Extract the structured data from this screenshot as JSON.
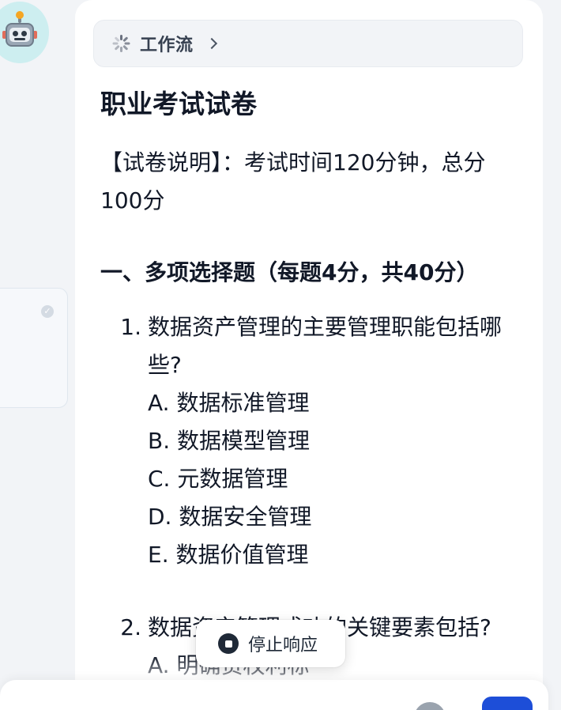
{
  "avatar": {
    "icon": "robot-icon"
  },
  "workflow": {
    "label": "工作流"
  },
  "document": {
    "title": "职业考试试卷",
    "description": "【试卷说明】：考试时间120分钟，总分100分",
    "section": {
      "title": "一、多项选择题（每题4分，共40分）",
      "questions": [
        {
          "number": "1.",
          "text": "数据资产管理的主要管理职能包括哪些?",
          "options": [
            "A. 数据标准管理",
            "B. 数据模型管理",
            "C. 元数据管理",
            "D. 数据安全管理",
            "E. 数据价值管理"
          ]
        },
        {
          "number": "2.",
          "text": "数据资产管理成功的关键要素包括?",
          "options": [
            "A. 明确责权利标"
          ]
        }
      ]
    }
  },
  "stop": {
    "label": "停止响应"
  },
  "colors": {
    "accent": "#1d4ed8",
    "avatar_bg": "#cdeef0",
    "card_bg": "#ffffff",
    "page_bg": "#f2f4f7"
  }
}
